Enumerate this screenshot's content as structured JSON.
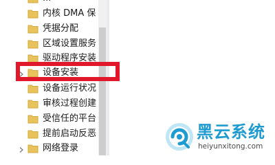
{
  "tree": {
    "items": [
      {
        "label": "...",
        "has_chevron": false
      },
      {
        "label": "内核 DMA 保",
        "has_chevron": false
      },
      {
        "label": "凭据分配",
        "has_chevron": false
      },
      {
        "label": "区域设置服务",
        "has_chevron": false
      },
      {
        "label": "驱动程序安装",
        "has_chevron": false
      },
      {
        "label": "设备安装",
        "has_chevron": true
      },
      {
        "label": "设备运行状况",
        "has_chevron": false
      },
      {
        "label": "审核过程创建",
        "has_chevron": false
      },
      {
        "label": "受信任的平台",
        "has_chevron": false
      },
      {
        "label": "提前启动反恶",
        "has_chevron": false
      },
      {
        "label": "网络登录",
        "has_chevron": true
      }
    ],
    "highlighted_item": "设备安装"
  },
  "watermark": {
    "title": "黑云系统",
    "url": "heiyunxitong.com"
  },
  "colors": {
    "folder": "#e8c25a",
    "highlight": "#e0182a",
    "watermark_title": "#1f9bd1",
    "watermark_url": "#4a4a4a"
  }
}
